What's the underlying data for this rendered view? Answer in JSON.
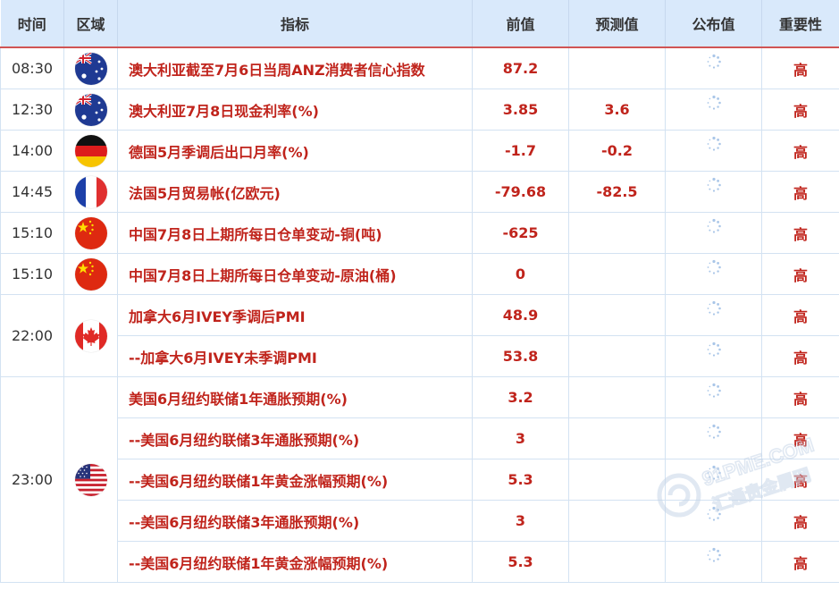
{
  "header": {
    "time": "时间",
    "region": "区域",
    "indicator": "指标",
    "previous": "前值",
    "forecast": "预测值",
    "actual": "公布值",
    "importance": "重要性"
  },
  "rows": [
    {
      "time": "08:30",
      "flag": "AU",
      "indicator": "澳大利亚截至7月6日当周ANZ消费者信心指数",
      "previous": "87.2",
      "forecast": "",
      "importance": "高"
    },
    {
      "time": "12:30",
      "flag": "AU",
      "indicator": "澳大利亚7月8日现金利率(%)",
      "previous": "3.85",
      "forecast": "3.6",
      "importance": "高"
    },
    {
      "time": "14:00",
      "flag": "DE",
      "indicator": "德国5月季调后出口月率(%)",
      "previous": "-1.7",
      "forecast": "-0.2",
      "importance": "高"
    },
    {
      "time": "14:45",
      "flag": "FR",
      "indicator": "法国5月贸易帐(亿欧元)",
      "previous": "-79.68",
      "forecast": "-82.5",
      "importance": "高"
    },
    {
      "time": "15:10",
      "flag": "CN",
      "indicator": "中国7月8日上期所每日仓单变动-铜(吨)",
      "previous": "-625",
      "forecast": "",
      "importance": "高"
    },
    {
      "time": "15:10",
      "flag": "CN",
      "indicator": "中国7月8日上期所每日仓单变动-原油(桶)",
      "previous": "0",
      "forecast": "",
      "importance": "高"
    },
    {
      "time": "22:00",
      "flag": "CA",
      "indicator": "加拿大6月IVEY季调后PMI",
      "previous": "48.9",
      "forecast": "",
      "importance": "高"
    },
    {
      "time": "",
      "flag": "",
      "indicator": "--加拿大6月IVEY未季调PMI",
      "previous": "53.8",
      "forecast": "",
      "importance": "高"
    },
    {
      "time": "23:00",
      "flag": "US",
      "indicator": "美国6月纽约联储1年通胀预期(%)",
      "previous": "3.2",
      "forecast": "",
      "importance": "高"
    },
    {
      "time": "",
      "flag": "",
      "indicator": "--美国6月纽约联储3年通胀预期(%)",
      "previous": "3",
      "forecast": "",
      "importance": "高"
    },
    {
      "time": "",
      "flag": "",
      "indicator": "--美国6月纽约联储1年黄金涨幅预期(%)",
      "previous": "5.3",
      "forecast": "",
      "importance": "高"
    },
    {
      "time": "",
      "flag": "",
      "indicator": "--美国6月纽约联储3年通胀预期(%)",
      "previous": "3",
      "forecast": "",
      "importance": "高"
    },
    {
      "time": "",
      "flag": "",
      "indicator": "--美国6月纽约联储1年黄金涨幅预期(%)",
      "previous": "5.3",
      "forecast": "",
      "importance": "高"
    }
  ],
  "icons": {
    "actual_pending": "loading-spinner-icon",
    "watermark": "fx678-watermark-logo"
  },
  "watermark": {
    "text_top": "91PME.COM",
    "text_bottom": "汇通贵金属网"
  },
  "colors": {
    "header_bg": "#d9e9fb",
    "header_rule": "#d05454",
    "value_red": "#c0241c",
    "grid": "#d3e2f2"
  }
}
